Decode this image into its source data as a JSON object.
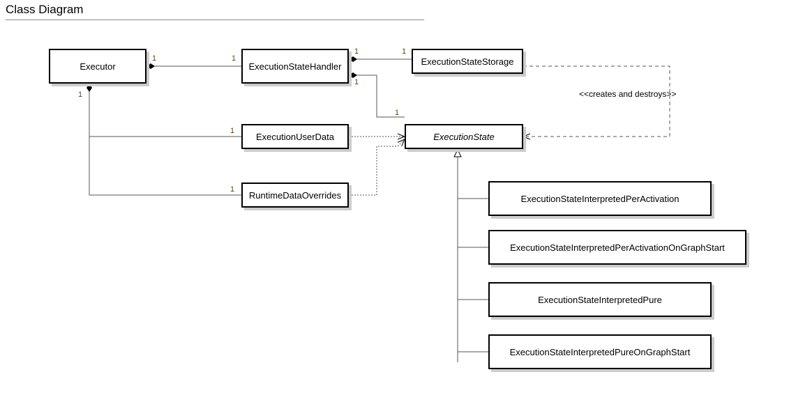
{
  "title": "Class Diagram",
  "boxes": {
    "executor": "Executor",
    "handler": "ExecutionStateHandler",
    "storage": "ExecutionStateStorage",
    "userdata": "ExecutionUserData",
    "overrides": "RuntimeDataOverrides",
    "state": "ExecutionState",
    "sub1": "ExecutionStateInterpretedPerActivation",
    "sub2": "ExecutionStateInterpretedPerActivationOnGraphStart",
    "sub3": "ExecutionStateInterpretedPure",
    "sub4": "ExecutionStateInterpretedPureOnGraphStart"
  },
  "multiplicities": {
    "exec_right": "1",
    "handler_left": "1",
    "handler_right": "1",
    "storage_left": "1",
    "handler_bottom": "1",
    "state_top": "1",
    "exec_bottom": "1",
    "userdata_left": "1",
    "overrides_left": "1"
  },
  "annotation": "<<creates and destroys>>"
}
